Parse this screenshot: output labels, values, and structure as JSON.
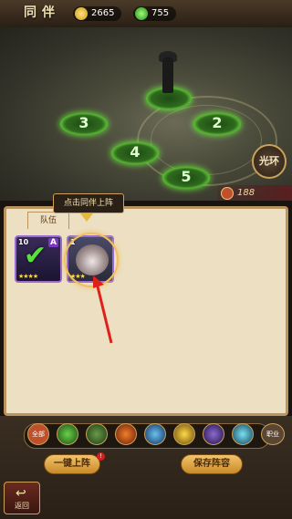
{
  "header": {
    "title": "同伴"
  },
  "resources": [
    {
      "icon": "gold-coin-icon",
      "value": "2665"
    },
    {
      "icon": "green-gem-icon",
      "value": "755"
    }
  ],
  "scene": {
    "slots": [
      "3",
      "2",
      "4",
      "5"
    ],
    "aura_button": "光环",
    "power": "188"
  },
  "tooltip": {
    "text": "点击同伴上阵"
  },
  "panel": {
    "tab_label": "队伍",
    "cards": [
      {
        "level": "10",
        "rank": "A",
        "stars": "★★★★",
        "deployed": true
      },
      {
        "level": "1",
        "rank": "",
        "stars": "★★★",
        "deployed": false
      }
    ]
  },
  "filters": [
    "全部",
    "",
    "",
    "",
    "",
    "",
    "",
    "职业"
  ],
  "buttons": {
    "one_click": "一键上阵",
    "one_click_badge": "!",
    "save": "保存阵容"
  },
  "back": {
    "label": "返回"
  }
}
